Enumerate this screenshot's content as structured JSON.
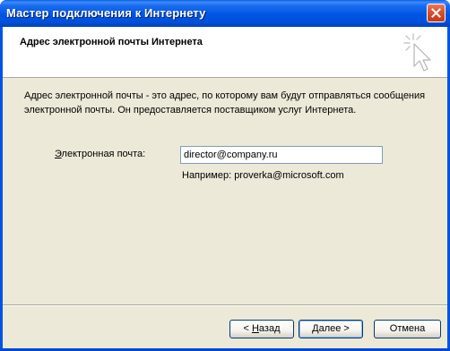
{
  "window": {
    "title": "Мастер подключения к Интернету"
  },
  "header": {
    "title": "Адрес электронной почты Интернета"
  },
  "content": {
    "description": "Адрес электронной почты - это адрес, по которому вам будут отправляться сообщения электронной почты. Он предоставляется поставщиком услуг Интернета.",
    "email_label_accel": "Э",
    "email_label_rest": "лектронная почта:",
    "email_value": "director@company.ru",
    "example": "Например: proverka@microsoft.com"
  },
  "buttons": {
    "back_prefix": "< ",
    "back_accel": "Н",
    "back_rest": "азад",
    "next_accel": "Д",
    "next_rest": "алее >",
    "cancel": "Отмена"
  },
  "icons": {
    "close": "close-icon",
    "wizard": "cursor-click-icon"
  },
  "colors": {
    "titlebar": "#0054e3",
    "dialog_bg": "#ece9d8",
    "header_bg": "#ffffff",
    "close_button": "#d6512f"
  }
}
